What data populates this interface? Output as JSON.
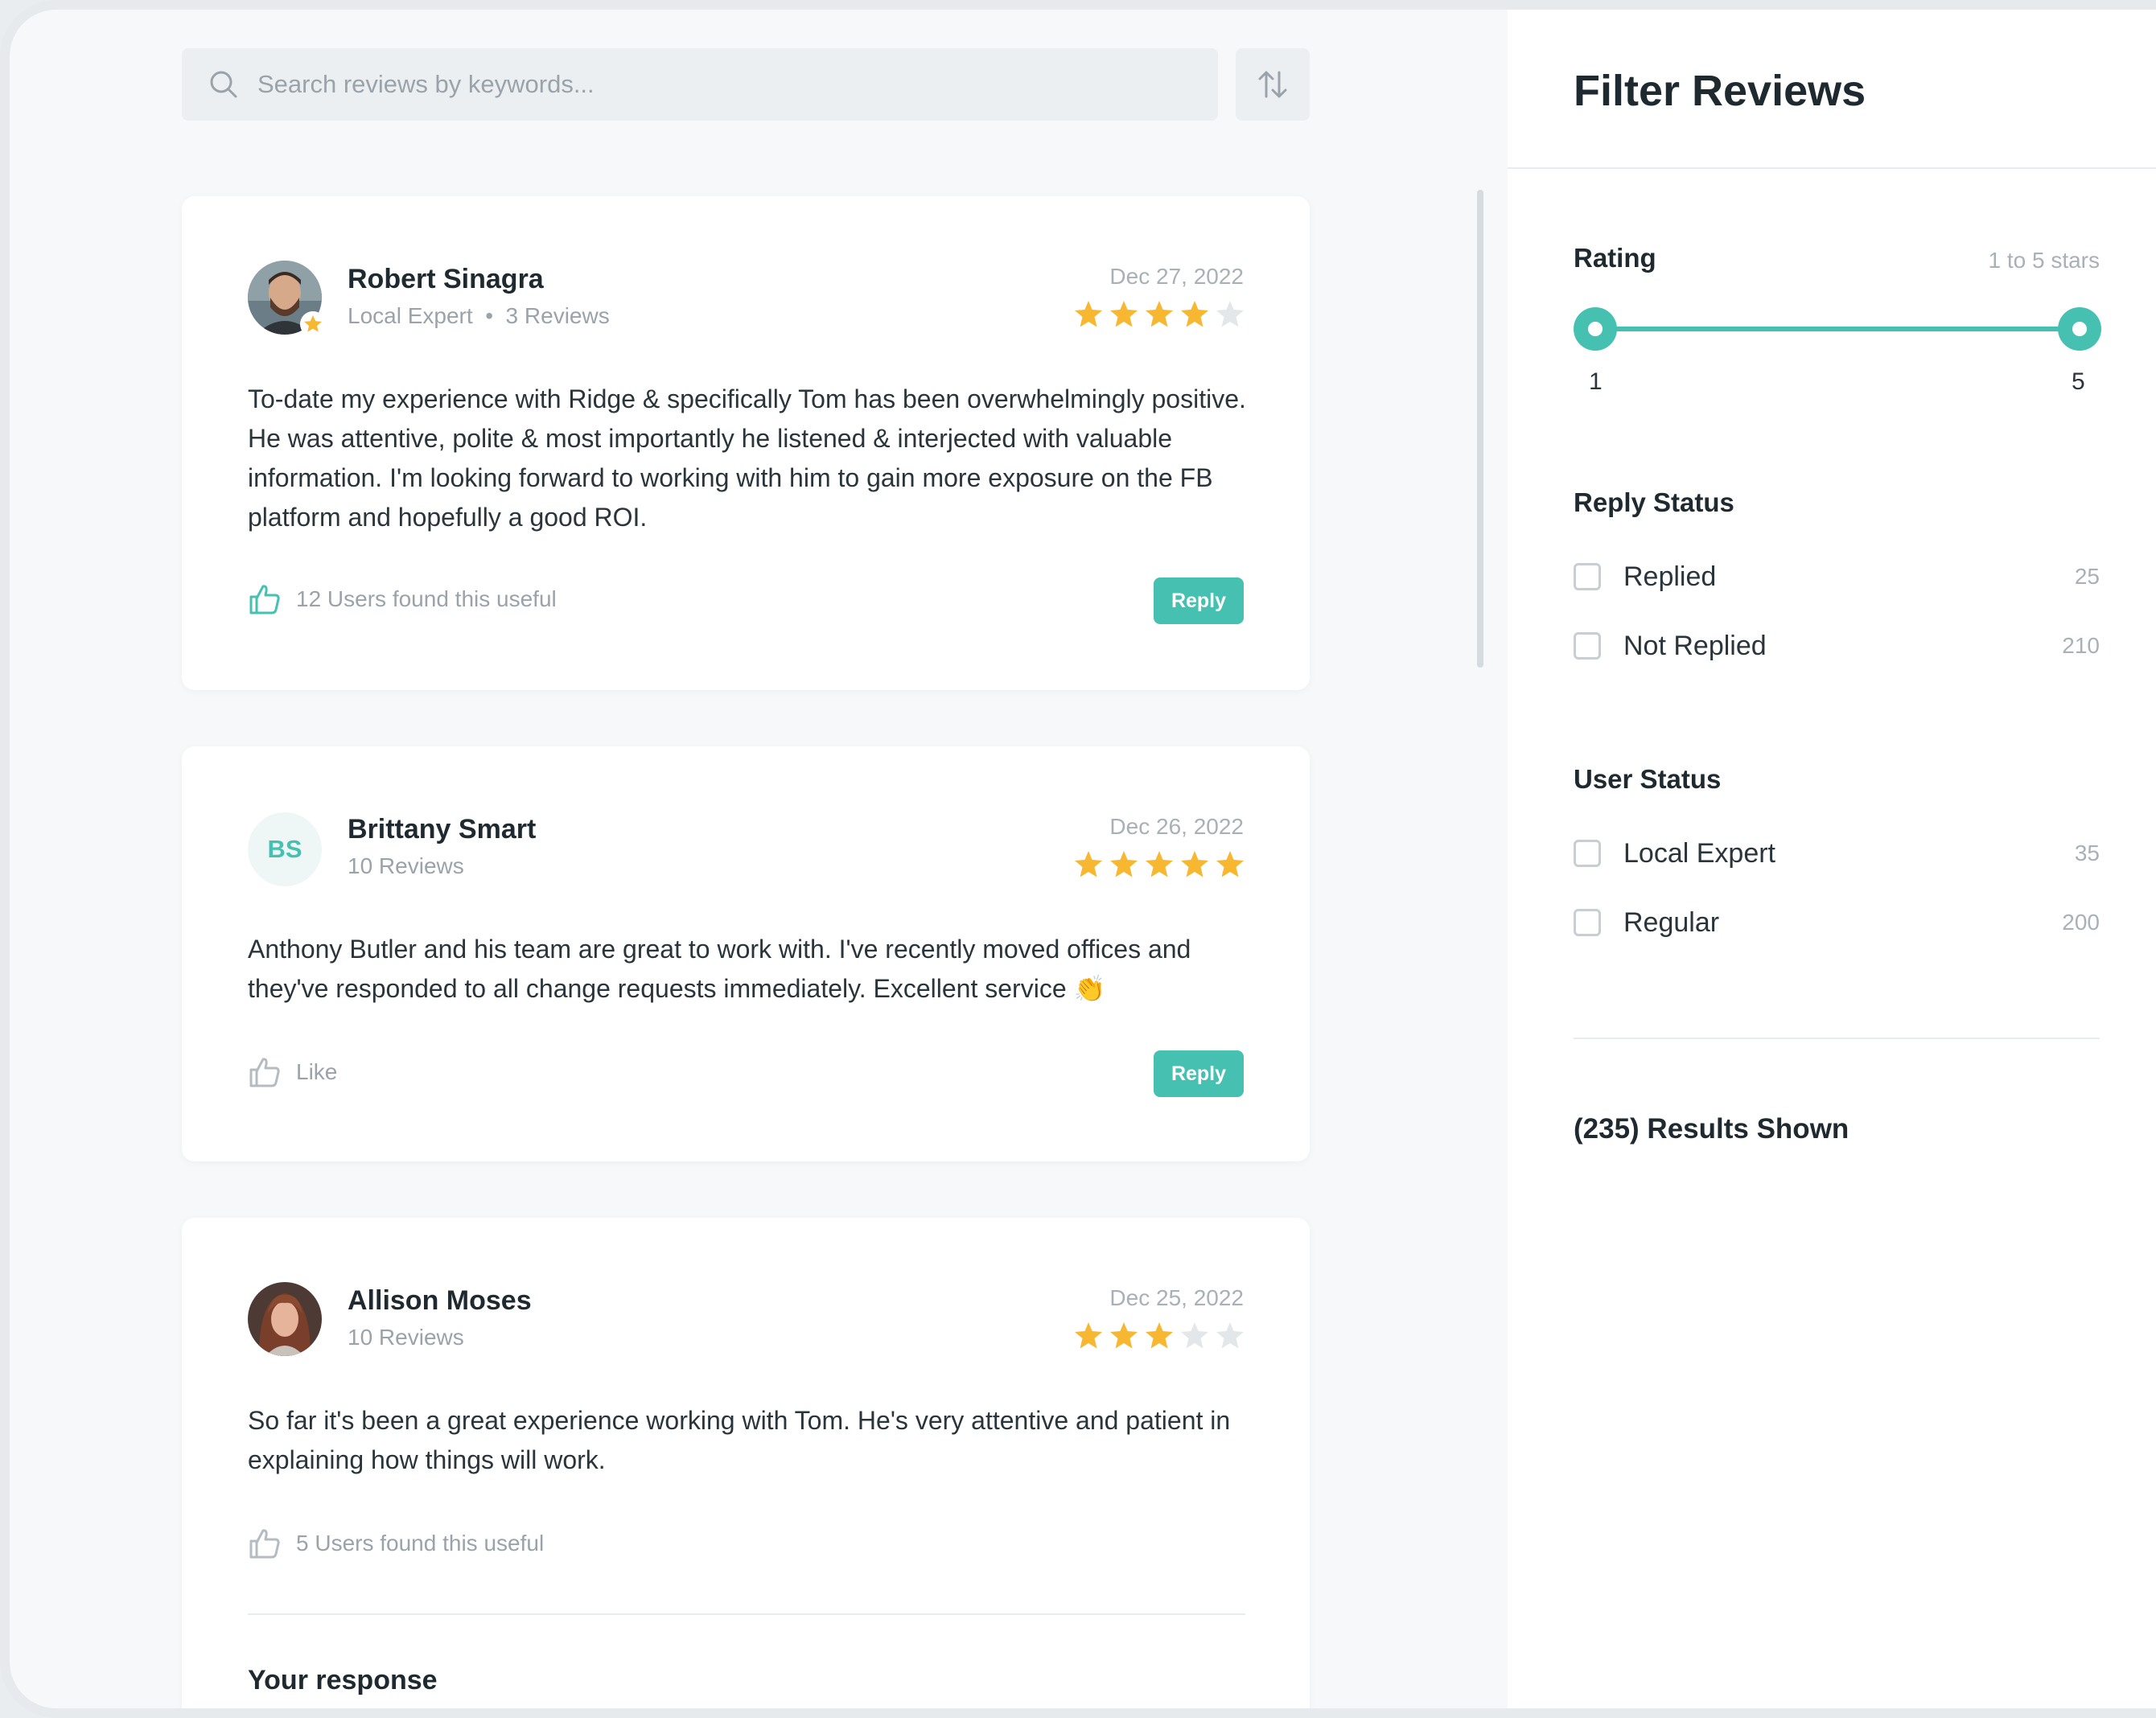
{
  "search": {
    "placeholder": "Search reviews by keywords..."
  },
  "reviews": [
    {
      "name": "Robert Sinagra",
      "subtitle": "Local Expert  •  3 Reviews",
      "date": "Dec 27, 2022",
      "rating": 4,
      "text": "To-date my experience with Ridge & specifically Tom has been overwhelmingly positive. He was attentive, polite & most importantly he listened & interjected with valuable information. I'm looking forward to working with him to gain more exposure on the FB platform and hopefully a good ROI.",
      "useful": "12 Users found this useful",
      "reply": "Reply"
    },
    {
      "name": "Brittany Smart",
      "initials": "BS",
      "subtitle": "10 Reviews",
      "date": "Dec 26, 2022",
      "rating": 5,
      "text": "Anthony Butler and his team are great to work with. I've recently moved offices and they've responded to all change requests immediately. Excellent service 👏",
      "useful": "Like",
      "reply": "Reply"
    },
    {
      "name": "Allison Moses",
      "subtitle": "10 Reviews",
      "date": "Dec 25, 2022",
      "rating": 3,
      "text": "So far it's been a great experience working with Tom.  He's very attentive and patient in explaining how things will work.",
      "useful": "5 Users found this useful",
      "response_title": "Your response"
    }
  ],
  "filter": {
    "title": "Filter Reviews",
    "rating": {
      "label": "Rating",
      "hint": "1 to 5 stars",
      "min": "1",
      "max": "5"
    },
    "reply_status": {
      "label": "Reply Status",
      "options": [
        {
          "label": "Replied",
          "count": "25"
        },
        {
          "label": "Not Replied",
          "count": "210"
        }
      ]
    },
    "user_status": {
      "label": "User Status",
      "options": [
        {
          "label": "Local Expert",
          "count": "35"
        },
        {
          "label": "Regular",
          "count": "200"
        }
      ]
    },
    "results": "(235) Results Shown"
  },
  "colors": {
    "accent": "#46c1b1",
    "star": "#f7b731",
    "star_empty": "#e3e7ea"
  },
  "icons": [
    "search-icon",
    "sort-icon",
    "star-icon",
    "thumbs-up-icon",
    "checkbox-icon"
  ]
}
